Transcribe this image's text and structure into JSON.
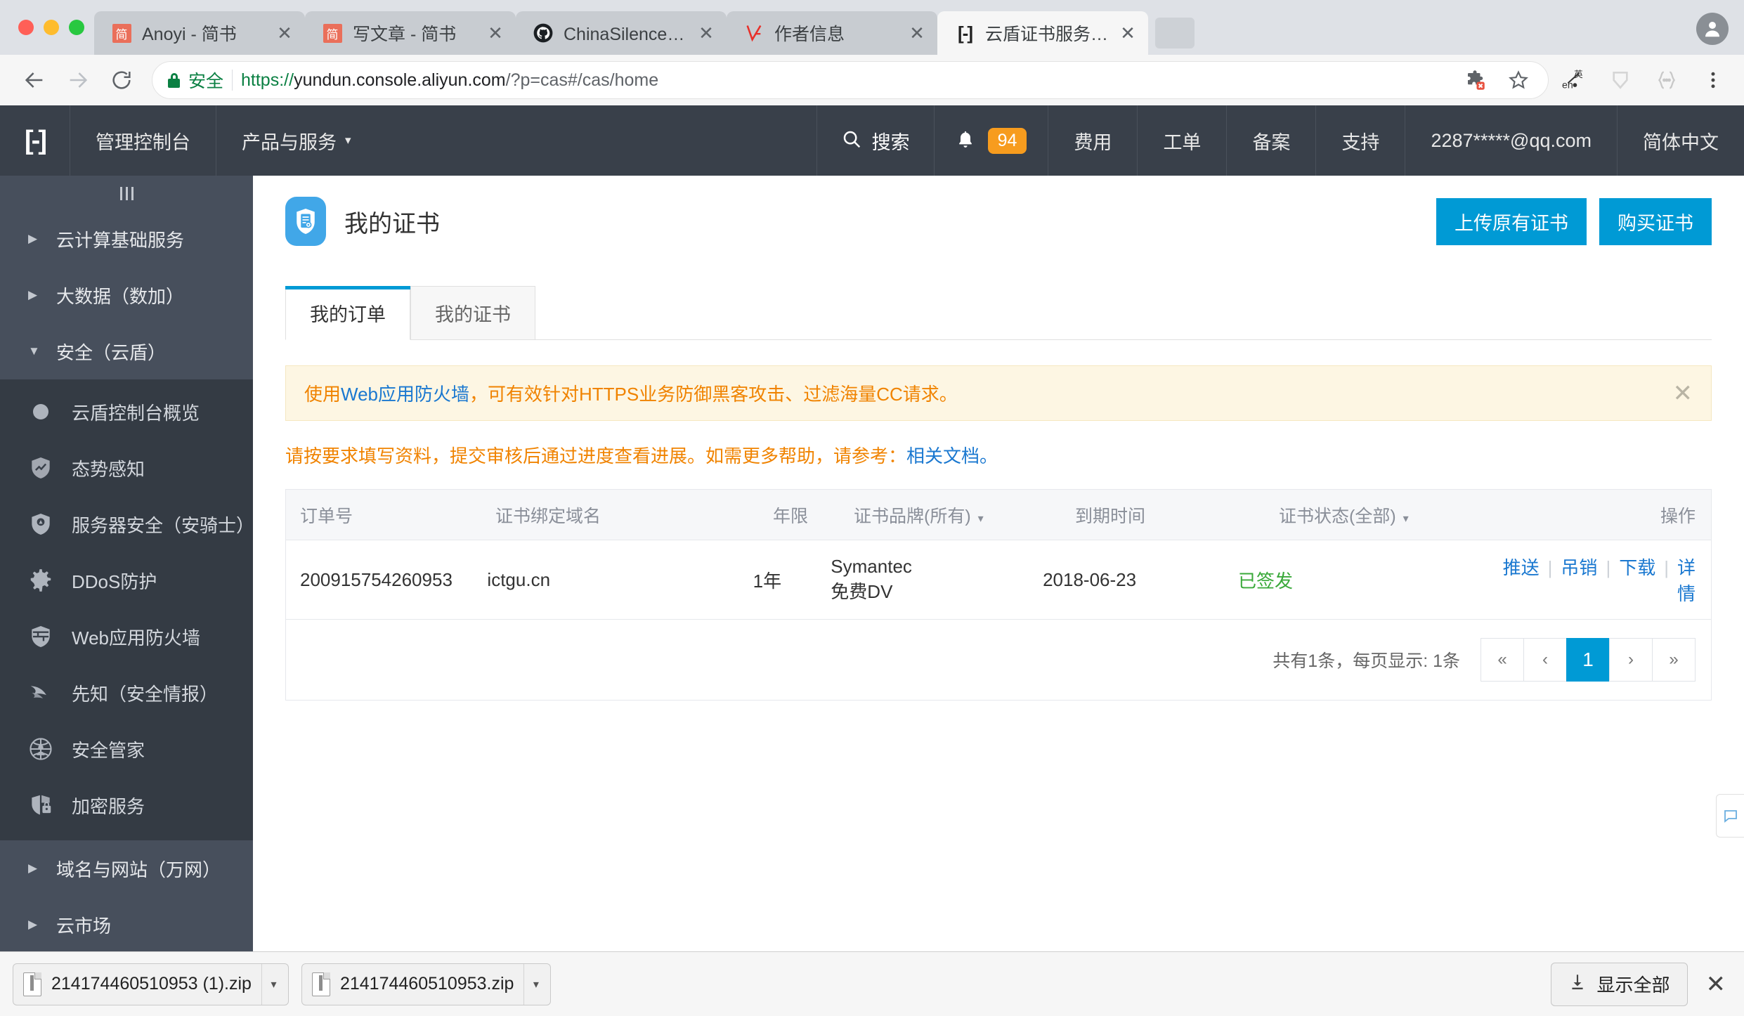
{
  "browser": {
    "tabs": [
      {
        "title": "Anoyi - 简书",
        "favicon": "jianshu-icon",
        "favicon_text": "简",
        "active": false
      },
      {
        "title": "写文章 - 简书",
        "favicon": "jianshu-icon",
        "favicon_text": "简",
        "active": false
      },
      {
        "title": "ChinaSilence (杨远东)",
        "favicon": "github-icon",
        "favicon_text": "",
        "active": false
      },
      {
        "title": "作者信息",
        "favicon": "v2ex-icon",
        "favicon_text": "",
        "active": false
      },
      {
        "title": "云盾证书服务管理控制台",
        "favicon": "aliyun-icon",
        "favicon_text": "",
        "active": true
      }
    ],
    "tab_close_label": "✕",
    "toolbar": {
      "back_label": "back-arrow",
      "forward_label": "forward-arrow",
      "reload_label": "reload",
      "secure_label": "安全",
      "url_scheme": "https://",
      "url_host": "yundun.console.aliyun.com",
      "url_path": "/?p=cas#/cas/home",
      "icons": [
        "extension-icon",
        "bookmark-star-icon",
        "translate-icon",
        "shield-icon",
        "devtools-braces-icon",
        "chrome-menu-icon"
      ]
    }
  },
  "console_nav": {
    "logo": "aliyun-logo",
    "console_label": "管理控制台",
    "products_label": "产品与服务",
    "products_caret": "▾",
    "search_label": "搜索",
    "notification_count": "94",
    "items": [
      "费用",
      "工单",
      "备案",
      "支持"
    ],
    "account": "2287*****@qq.com",
    "language": "简体中文"
  },
  "sidebar": {
    "collapse_label": "|||",
    "groups": [
      {
        "label": "云计算基础服务",
        "arrow": "▶",
        "expanded": false
      },
      {
        "label": "大数据（数加）",
        "arrow": "▶",
        "expanded": false
      },
      {
        "label": "安全（云盾）",
        "arrow": "▼",
        "expanded": true
      }
    ],
    "items": [
      {
        "label": "云盾控制台概览",
        "icon": "dot-icon"
      },
      {
        "label": "态势感知",
        "icon": "shield-chart-icon"
      },
      {
        "label": "服务器安全（安骑士）",
        "icon": "shield-knight-icon"
      },
      {
        "label": "DDoS防护",
        "icon": "gear-icon"
      },
      {
        "label": "Web应用防火墙",
        "icon": "shield-firewall-icon"
      },
      {
        "label": "先知（安全情报）",
        "icon": "radar-icon"
      },
      {
        "label": "安全管家",
        "icon": "person-network-icon"
      },
      {
        "label": "加密服务",
        "icon": "shield-lock-icon"
      }
    ],
    "groups_bottom": [
      {
        "label": "域名与网站（万网）",
        "arrow": "▶"
      },
      {
        "label": "云市场",
        "arrow": "▶"
      }
    ]
  },
  "main": {
    "page_icon": "certificate-shield-icon",
    "page_title": "我的证书",
    "upload_button": "上传原有证书",
    "buy_button": "购买证书",
    "tabs": [
      {
        "label": "我的订单",
        "active": true
      },
      {
        "label": "我的证书",
        "active": false
      }
    ],
    "alert": {
      "text_pre": "使用",
      "text_link": "Web应用防火墙",
      "text_post": "，可有效针对HTTPS业务防御黑客攻击、过滤海量CC请求。",
      "close": "✕"
    },
    "notice": {
      "text": "请按要求填写资料，提交审核后通过进度查看进展。如需更多帮助，请参考：",
      "link": "相关文档。"
    },
    "table": {
      "columns": [
        {
          "label": "订单号",
          "sortable": false
        },
        {
          "label": "证书绑定域名",
          "sortable": false
        },
        {
          "label": "年限",
          "sortable": false
        },
        {
          "label": "证书品牌(所有)",
          "sortable": true
        },
        {
          "label": "到期时间",
          "sortable": false
        },
        {
          "label": "证书状态(全部)",
          "sortable": true
        },
        {
          "label": "操作",
          "sortable": false
        }
      ],
      "sort_caret": "▾",
      "rows": [
        {
          "order_no": "200915754260953",
          "domain": "ictgu.cn",
          "years": "1年",
          "brand_line1": "Symantec",
          "brand_line2": "免费DV",
          "expire": "2018-06-23",
          "status": "已签发",
          "status_color": "#3aa93a",
          "operations": [
            "推送",
            "吊销",
            "下载",
            "详情"
          ]
        }
      ],
      "footer_summary": "共有1条，每页显示: 1条",
      "pager": [
        {
          "label": "«",
          "current": false
        },
        {
          "label": "‹",
          "current": false
        },
        {
          "label": "1",
          "current": true
        },
        {
          "label": "›",
          "current": false
        },
        {
          "label": "»",
          "current": false
        }
      ]
    },
    "feedback_icon": "feedback-icon"
  },
  "download_shelf": {
    "items": [
      {
        "name": "214174460510953 (1).zip",
        "caret": "▾"
      },
      {
        "name": "214174460510953.zip",
        "caret": "▾"
      }
    ],
    "show_all_label": "显示全部",
    "close_label": "✕"
  },
  "colors": {
    "accent": "#009ad5",
    "nav_bg": "#39404a",
    "sidebar_sub_bg": "#343b44",
    "badge_orange": "#f79c1e",
    "warn_text": "#f08300",
    "link_blue": "#1a78d0",
    "status_green": "#3aa93a"
  }
}
